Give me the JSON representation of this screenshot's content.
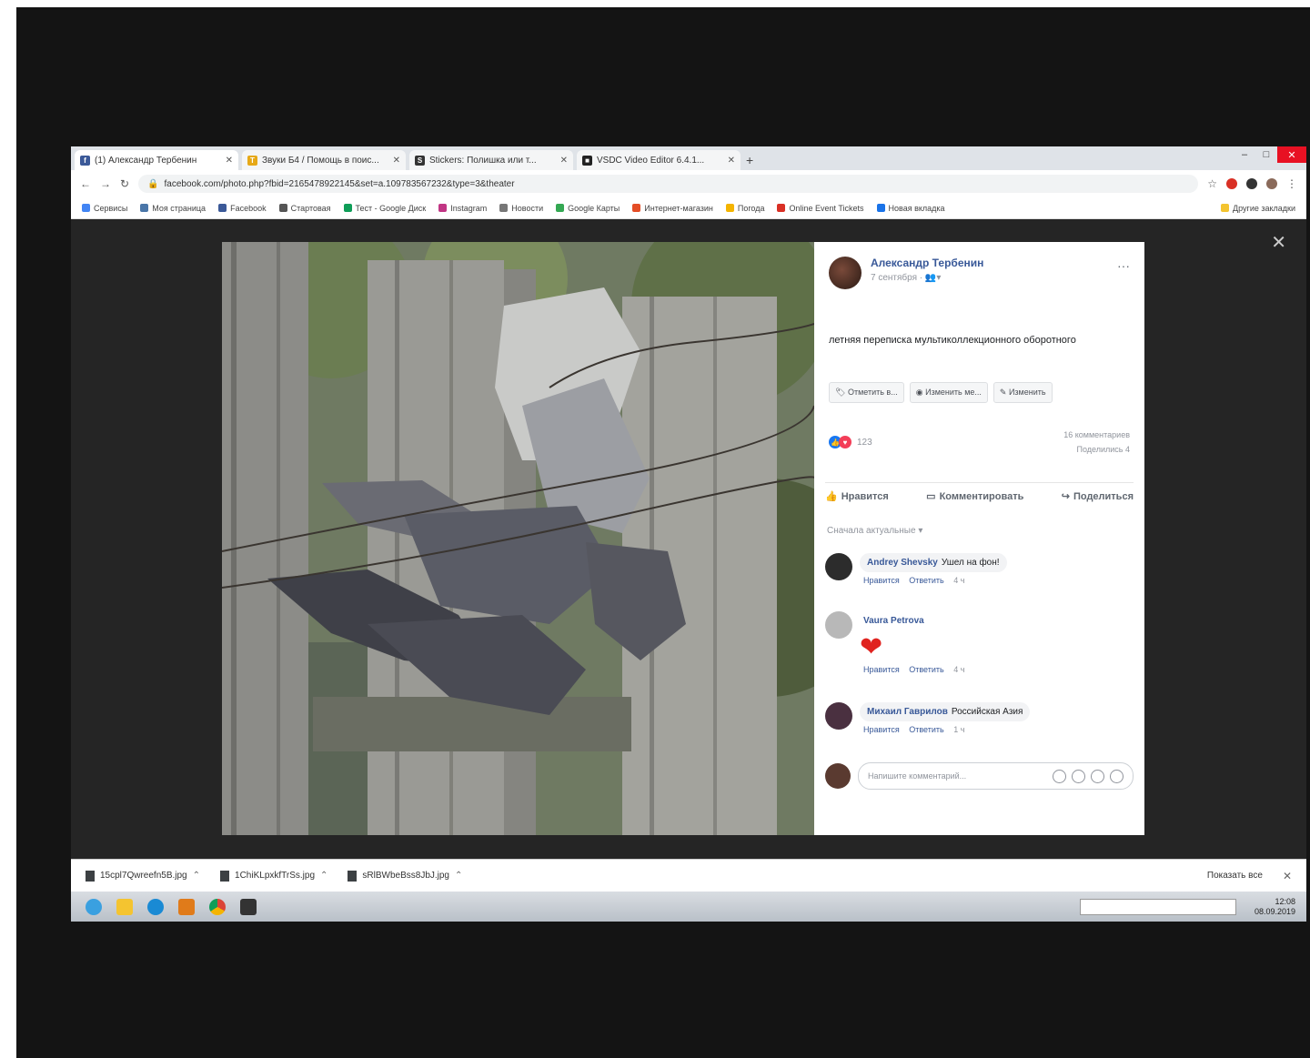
{
  "browser": {
    "tabs": [
      {
        "title": "(1) Александр Тербенин",
        "favicon_color": "#3b5998",
        "favicon_char": "f",
        "active": true
      },
      {
        "title": "Звуки Б4 / Помощь в поис...",
        "favicon_color": "#e6a817",
        "favicon_char": "T",
        "active": false
      },
      {
        "title": "Stickers: Полишка или т...",
        "favicon_color": "#333333",
        "favicon_char": "S",
        "active": false
      },
      {
        "title": "VSDC Video Editor 6.4.1...",
        "favicon_color": "#222222",
        "favicon_char": "■",
        "active": false
      }
    ],
    "new_tab": "+",
    "url": "facebook.com/photo.php?fbid=2165478922145&set=a.109783567232&type=3&theater",
    "bookmarks": [
      {
        "label": "Сервисы",
        "color": "#4285f4"
      },
      {
        "label": "Моя страница",
        "color": "#4a76a8"
      },
      {
        "label": "Facebook",
        "color": "#3b5998"
      },
      {
        "label": "Стартовая",
        "color": "#555555"
      },
      {
        "label": "Тест - Google Диск",
        "color": "#0f9d58"
      },
      {
        "label": "Instagram",
        "color": "#c13584"
      },
      {
        "label": "Новости",
        "color": "#777777"
      },
      {
        "label": "Google Карты",
        "color": "#34a853"
      },
      {
        "label": "Интернет-магазин",
        "color": "#e44d26"
      },
      {
        "label": "Погода",
        "color": "#f4b400"
      },
      {
        "label": "Online Event Tickets",
        "color": "#d93025"
      },
      {
        "label": "Новая вкладка",
        "color": "#1a73e8"
      }
    ],
    "other_bookmarks": "Другие закладки"
  },
  "viewer": {
    "close": "✕",
    "author_name": "Александр Тербенин",
    "author_meta": "7 сентября · 👥▾",
    "post_text": "летняя переписка мультиколлекционного оборотного",
    "post_buttons": [
      "Отметить в...",
      "Изменить ме...",
      "Изменить"
    ],
    "reactions_count": "123",
    "stats_line1": "16 комментариев",
    "stats_line2": "Поделились 4",
    "actions": [
      "Нравится",
      "Комментировать",
      "Поделиться"
    ],
    "sort_label": "Сначала актуальные ▾",
    "comments": [
      {
        "author": "Andrey Shevsky",
        "text": "Ушел на фон!",
        "like": "Нравится",
        "reply": "Ответить",
        "time": "4 ч",
        "avatar": "#2c2c2c"
      },
      {
        "author": "Vaura Petrova",
        "text": "",
        "like": "Нравится",
        "reply": "Ответить",
        "time": "4 ч",
        "avatar": "#b8b8b8",
        "heart": "❤"
      },
      {
        "author": "Михаил Гаврилов",
        "text": "Российская Азия",
        "like": "Нравится",
        "reply": "Ответить",
        "time": "1 ч",
        "avatar": "#4a3040"
      }
    ],
    "compose_placeholder": "Напишите комментарий..."
  },
  "downloads": {
    "items": [
      "15cpl7Qwreefn5B.jpg",
      "1ChiKLpxkfTrSs.jpg",
      "sRlBWbeBss8JbJ.jpg"
    ],
    "show_all": "Показать все",
    "close": "✕"
  },
  "taskbar": {
    "clock_time": "12:08",
    "clock_date": "08.09.2019"
  }
}
